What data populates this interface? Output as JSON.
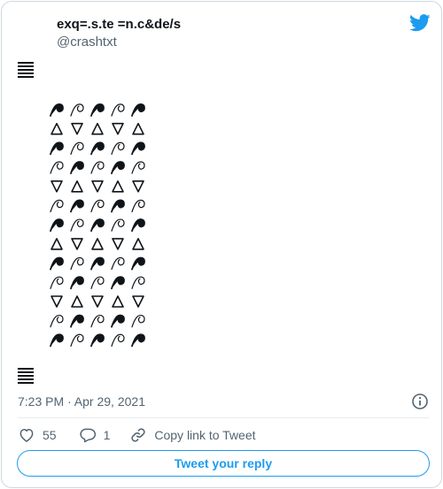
{
  "tweet": {
    "display_name": "exq=.s.te =n.c&de/s",
    "handle": "@crashtxt",
    "timestamp": "7:23 PM · Apr 29, 2021"
  },
  "actions": {
    "like_count": "55",
    "reply_count": "1",
    "copy_link_label": "Copy link to Tweet"
  },
  "reply_button_label": "Tweet your reply",
  "icons": {
    "logo": "twitter-bird-icon",
    "info": "info-icon",
    "like": "heart-icon",
    "reply": "reply-bubble-icon",
    "link": "link-icon",
    "glyph": "hexagram-glyph-icon"
  },
  "colors": {
    "brand": "#1d9bf0",
    "text": "#0f1419",
    "muted": "#536471",
    "border": "#cfd9de"
  }
}
